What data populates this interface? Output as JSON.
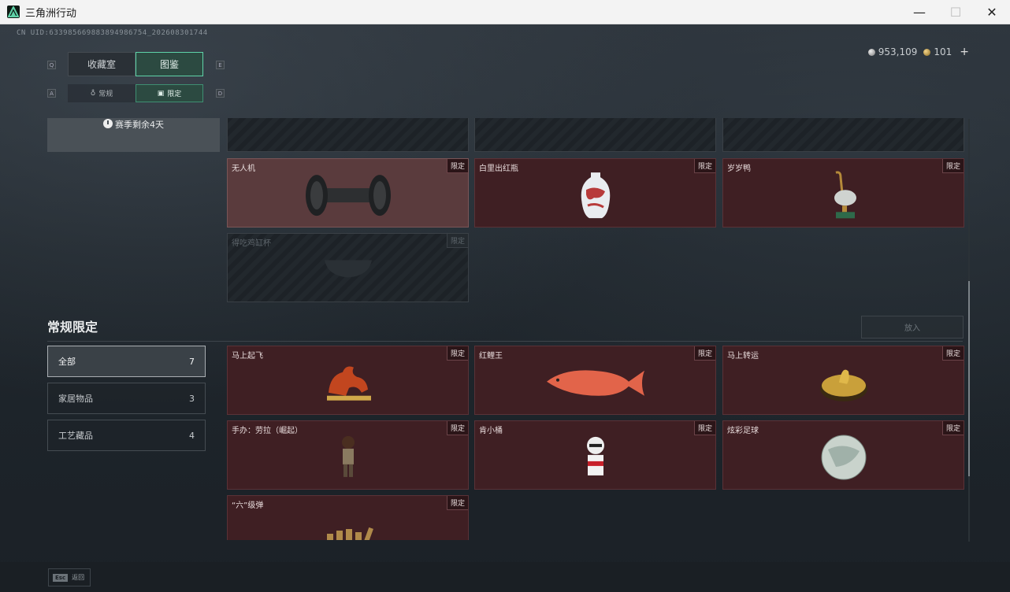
{
  "window": {
    "title": "三角洲行动",
    "minimize": "—",
    "maximize": "☐",
    "close": "✕"
  },
  "uid": "CN UID:633985669883894986754_202608301744",
  "currency": {
    "silver": "953,109",
    "gold": "101",
    "plus": "+"
  },
  "key_hints": {
    "q": "Q",
    "e": "E",
    "a": "A",
    "d": "D"
  },
  "main_tabs": [
    {
      "label": "收藏室"
    },
    {
      "label": "图鉴"
    }
  ],
  "sub_tabs": [
    {
      "label": "常规"
    },
    {
      "label": "限定"
    }
  ],
  "season": "赛季剩余4天",
  "limited_cards": [
    {
      "name": "无人机",
      "badge": "限定"
    },
    {
      "name": "白里出红瓶",
      "badge": "限定"
    },
    {
      "name": "岁岁鸭",
      "badge": "限定"
    },
    {
      "name": "得吃鸡缸杯",
      "badge": "限定"
    }
  ],
  "section": {
    "title": "常规限定",
    "place_button": "放入"
  },
  "filters": [
    {
      "label": "全部",
      "count": "7"
    },
    {
      "label": "家居物品",
      "count": "3"
    },
    {
      "label": "工艺藏品",
      "count": "4"
    }
  ],
  "regular_cards": [
    {
      "name": "马上起飞",
      "badge": "限定"
    },
    {
      "name": "红鲤王",
      "badge": "限定"
    },
    {
      "name": "马上转运",
      "badge": "限定"
    },
    {
      "name": "手办：劳拉（崛起）",
      "badge": "限定"
    },
    {
      "name": "肯小桶",
      "badge": "限定"
    },
    {
      "name": "炫彩足球",
      "badge": "限定"
    },
    {
      "name": "“六”级弹",
      "badge": "限定"
    }
  ],
  "bottom": {
    "esc_key": "Esc",
    "esc_label": "返回"
  },
  "colors": {
    "accent": "#5fd3a8",
    "card_red": "#3f1f23",
    "card_highlight": "#5a3b3d"
  }
}
